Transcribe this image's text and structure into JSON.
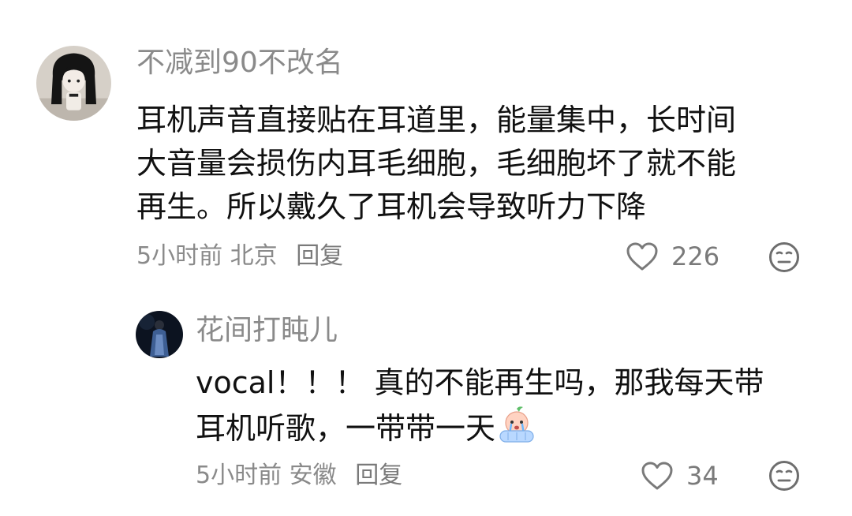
{
  "comments": [
    {
      "username": "不减到90不改名",
      "lines": [
        "耳机声音直接贴在耳道里，能量集中，长时间",
        "大音量会损伤内耳毛细胞，毛细胞坏了就不能",
        "再生。所以戴久了耳机会导致听力下降"
      ],
      "time": "5小时前",
      "location": "北京",
      "reply_label": "回复",
      "likes": "226",
      "avatar_icon": "avatar-girl-icon"
    },
    {
      "username": "花间打盹儿",
      "lines": [
        "vocal！！！ 真的不能再生吗，那我每天带",
        "耳机听歌，一带带一天"
      ],
      "emoji": "crying-peach-emoji-icon",
      "time": "5小时前",
      "location": "安徽",
      "reply_label": "回复",
      "likes": "34",
      "avatar_icon": "avatar-dark-figure-icon"
    }
  ],
  "icons": {
    "like": "heart-outline-icon",
    "dislike": "neutral-face-icon"
  },
  "colors": {
    "text_primary": "#111111",
    "text_secondary": "#8a8a8a",
    "background": "#ffffff"
  }
}
